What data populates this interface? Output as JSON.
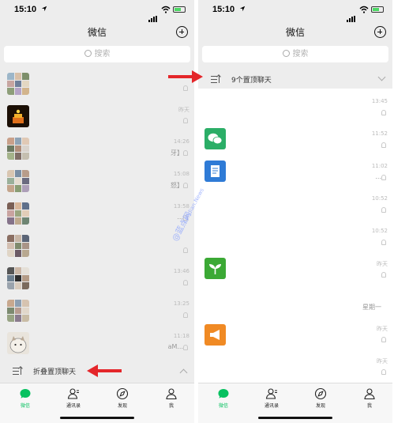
{
  "status": {
    "time": "15:10"
  },
  "nav": {
    "title": "微信"
  },
  "search": {
    "placeholder": "搜索"
  },
  "left": {
    "fold_label": "折叠置顶聊天",
    "rows": [
      {
        "time": "",
        "snippet": ""
      },
      {
        "time": "昨天",
        "snippet": ""
      },
      {
        "time": "14:26",
        "snippet": "牙】"
      },
      {
        "time": "15:08",
        "snippet": "怒】"
      },
      {
        "time": "13:58",
        "snippet": "..."
      },
      {
        "time": "",
        "snippet": ""
      },
      {
        "time": "13:46",
        "snippet": ""
      },
      {
        "time": "13:25",
        "snippet": ""
      },
      {
        "time": "11:18",
        "snippet": "aM..."
      }
    ]
  },
  "right": {
    "fold_label": "9个置顶聊天",
    "rows": [
      {
        "time": "13:45",
        "snippet": ""
      },
      {
        "time": "11:52",
        "snippet": ""
      },
      {
        "time": "11:02",
        "snippet": "..."
      },
      {
        "time": "10:52",
        "snippet": ""
      },
      {
        "time": "10:52",
        "snippet": ""
      },
      {
        "time": "昨天",
        "snippet": ""
      },
      {
        "time": "",
        "snippet": "星期一"
      },
      {
        "time": "昨天",
        "snippet": ""
      },
      {
        "time": "昨天",
        "snippet": ""
      }
    ],
    "icon_colors": {
      "wechat": "#2bae67",
      "doc": "#2f7bd6",
      "plant": "#3ba935",
      "horn": "#f08a24"
    }
  },
  "tabs": [
    {
      "label": "微信",
      "icon": "chat-bubble-icon"
    },
    {
      "label": "通讯录",
      "icon": "contacts-icon"
    },
    {
      "label": "发现",
      "icon": "compass-icon"
    },
    {
      "label": "我",
      "icon": "person-icon"
    }
  ],
  "watermark": {
    "text": "@蓝点网",
    "subtext": "Landian.News"
  },
  "colors": {
    "active_green": "#07c160",
    "red_arrow": "#e4262a"
  }
}
